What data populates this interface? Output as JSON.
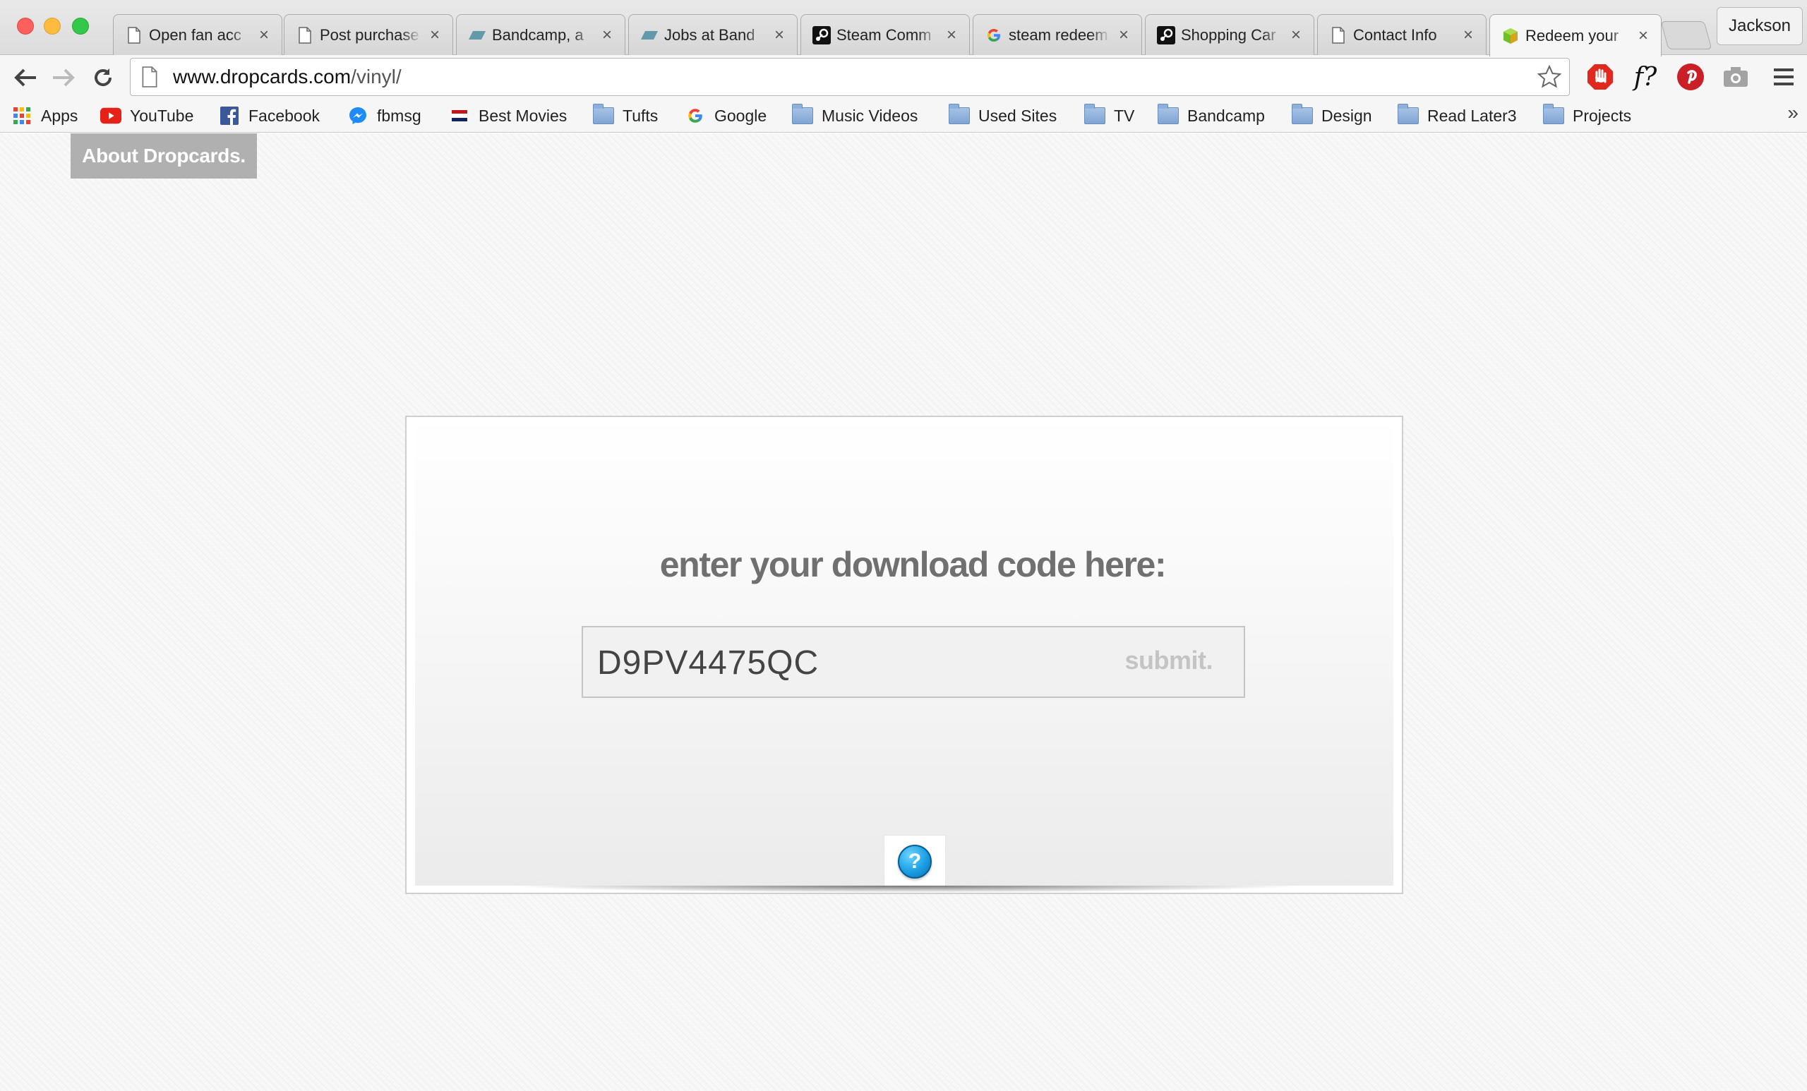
{
  "browser": {
    "tabs": [
      {
        "title": "Open fan acc",
        "favicon": "document-icon"
      },
      {
        "title": "Post purchase",
        "favicon": "document-icon"
      },
      {
        "title": "Bandcamp, a",
        "favicon": "bandcamp-icon"
      },
      {
        "title": "Jobs at Band",
        "favicon": "bandcamp-icon"
      },
      {
        "title": "Steam Comm",
        "favicon": "steam-icon"
      },
      {
        "title": "steam redeem",
        "favicon": "google-icon"
      },
      {
        "title": "Shopping Car",
        "favicon": "steam-icon"
      },
      {
        "title": "Contact Info",
        "favicon": "document-icon"
      },
      {
        "title": "Redeem your",
        "favicon": "dropcards-icon",
        "active": true
      }
    ],
    "profile_name": "Jackson",
    "url_host": "www.dropcards.com",
    "url_path": "/vinyl/",
    "bookmarks": [
      {
        "label": "Apps",
        "icon": "apps-grid-icon"
      },
      {
        "label": "YouTube",
        "icon": "youtube-icon"
      },
      {
        "label": "Facebook",
        "icon": "facebook-icon"
      },
      {
        "label": "fbmsg",
        "icon": "messenger-icon"
      },
      {
        "label": "Best Movies",
        "icon": "flag-icon"
      },
      {
        "label": "Tufts",
        "icon": "folder-icon"
      },
      {
        "label": "Google",
        "icon": "google-icon"
      },
      {
        "label": "Music Videos",
        "icon": "folder-icon"
      },
      {
        "label": "Used Sites",
        "icon": "folder-icon"
      },
      {
        "label": "TV",
        "icon": "folder-icon"
      },
      {
        "label": "Bandcamp",
        "icon": "folder-icon"
      },
      {
        "label": "Design",
        "icon": "folder-icon"
      },
      {
        "label": "Read Later3",
        "icon": "folder-icon"
      },
      {
        "label": "Projects",
        "icon": "folder-icon"
      }
    ],
    "bookmarks_overflow": "»",
    "extension_label": "f?"
  },
  "page": {
    "about_label": "About Dropcards.",
    "prompt": "enter your download code here:",
    "code_value": "D9PV4475QC",
    "submit_label": "submit.",
    "help_glyph": "?"
  },
  "colors": {
    "about_bg": "#b0b0b0",
    "prompt_text": "#707070",
    "help_blue": "#1a9fe3"
  }
}
